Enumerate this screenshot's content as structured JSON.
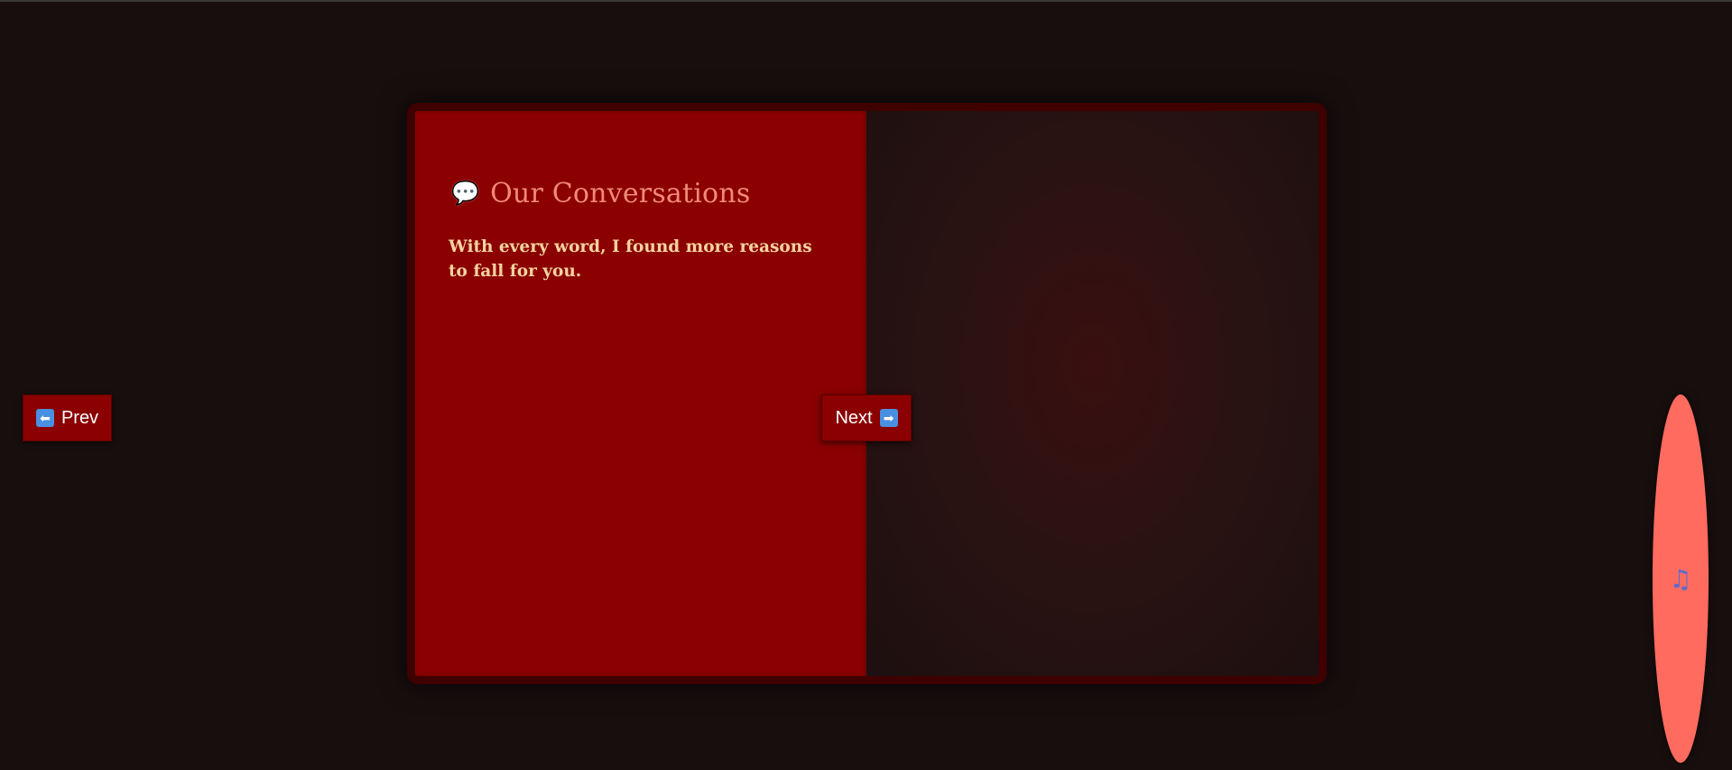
{
  "page": {
    "heading_icon": "💬",
    "heading": "Our Conversations",
    "text": "With every word, I found more reasons to fall for you."
  },
  "nav": {
    "prev_icon": "⬅",
    "prev_label": "Prev",
    "next_label": "Next",
    "next_icon": "➡"
  },
  "music": {
    "icon": "♫",
    "icon_name": "music-note-icon"
  },
  "colors": {
    "background": "#180e0e",
    "page_left": "#8b0000",
    "book_border": "#3f0000",
    "heading": "#f08a78",
    "text": "#f3d3a0",
    "music_button": "#ff6b5e",
    "arrow_icon": "#4a90e2"
  }
}
